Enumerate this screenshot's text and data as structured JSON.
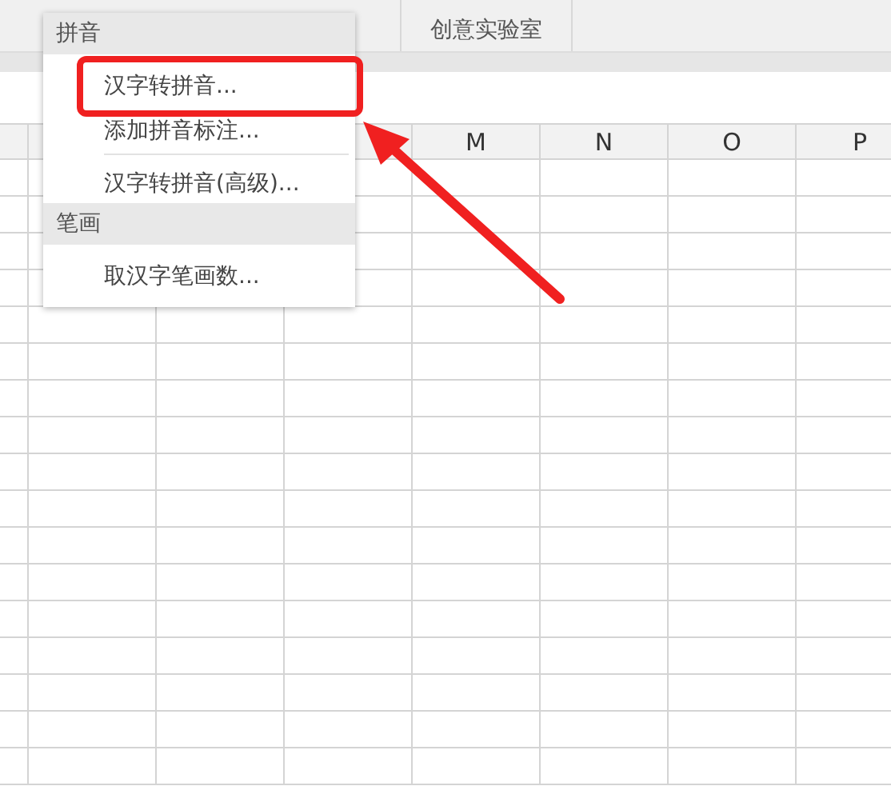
{
  "ribbon": {
    "group_label": "创意实验室"
  },
  "column_headers": [
    {
      "label": "M"
    },
    {
      "label": "N"
    },
    {
      "label": "O"
    },
    {
      "label": "P"
    }
  ],
  "menu": {
    "sections": [
      {
        "header": "拼音",
        "items": [
          {
            "label": "汉字转拼音...",
            "highlighted": true,
            "separator_after": false
          },
          {
            "label": "添加拼音标注...",
            "highlighted": false,
            "separator_after": true
          },
          {
            "label": "汉字转拼音(高级)...",
            "highlighted": false,
            "separator_after": false
          }
        ]
      },
      {
        "header": "笔画",
        "items": [
          {
            "label": "取汉字笔画数...",
            "highlighted": false,
            "separator_after": false
          }
        ]
      }
    ]
  }
}
